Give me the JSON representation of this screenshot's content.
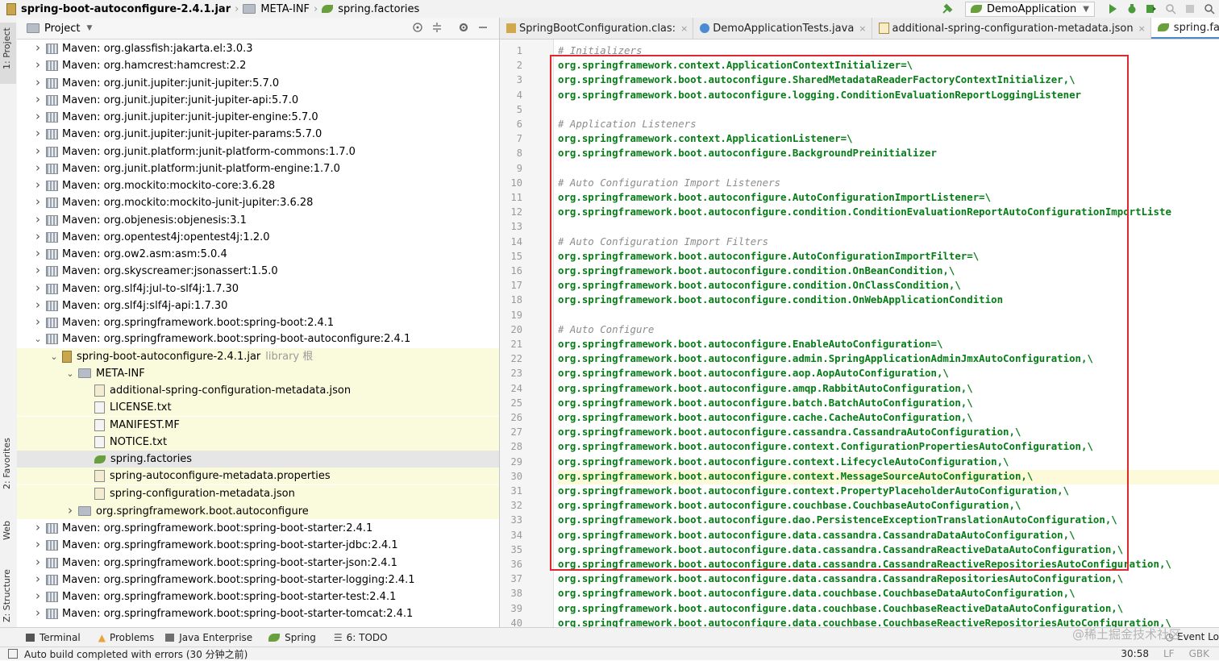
{
  "breadcrumb": [
    "spring-boot-autoconfigure-2.4.1.jar",
    "META-INF",
    "spring.factories"
  ],
  "run_config": "DemoApplication",
  "left_strip": [
    "1: Project",
    "2: Favorites",
    "Web",
    "Z: Structure"
  ],
  "project_panel": {
    "title": "Project"
  },
  "tree": [
    {
      "indent": 0,
      "chev": "right",
      "icon": "lib",
      "label": "Maven: org.glassfish:jakarta.el:3.0.3"
    },
    {
      "indent": 0,
      "chev": "right",
      "icon": "lib",
      "label": "Maven: org.hamcrest:hamcrest:2.2"
    },
    {
      "indent": 0,
      "chev": "right",
      "icon": "lib",
      "label": "Maven: org.junit.jupiter:junit-jupiter:5.7.0"
    },
    {
      "indent": 0,
      "chev": "right",
      "icon": "lib",
      "label": "Maven: org.junit.jupiter:junit-jupiter-api:5.7.0"
    },
    {
      "indent": 0,
      "chev": "right",
      "icon": "lib",
      "label": "Maven: org.junit.jupiter:junit-jupiter-engine:5.7.0"
    },
    {
      "indent": 0,
      "chev": "right",
      "icon": "lib",
      "label": "Maven: org.junit.jupiter:junit-jupiter-params:5.7.0"
    },
    {
      "indent": 0,
      "chev": "right",
      "icon": "lib",
      "label": "Maven: org.junit.platform:junit-platform-commons:1.7.0"
    },
    {
      "indent": 0,
      "chev": "right",
      "icon": "lib",
      "label": "Maven: org.junit.platform:junit-platform-engine:1.7.0"
    },
    {
      "indent": 0,
      "chev": "right",
      "icon": "lib",
      "label": "Maven: org.mockito:mockito-core:3.6.28"
    },
    {
      "indent": 0,
      "chev": "right",
      "icon": "lib",
      "label": "Maven: org.mockito:mockito-junit-jupiter:3.6.28"
    },
    {
      "indent": 0,
      "chev": "right",
      "icon": "lib",
      "label": "Maven: org.objenesis:objenesis:3.1"
    },
    {
      "indent": 0,
      "chev": "right",
      "icon": "lib",
      "label": "Maven: org.opentest4j:opentest4j:1.2.0"
    },
    {
      "indent": 0,
      "chev": "right",
      "icon": "lib",
      "label": "Maven: org.ow2.asm:asm:5.0.4"
    },
    {
      "indent": 0,
      "chev": "right",
      "icon": "lib",
      "label": "Maven: org.skyscreamer:jsonassert:1.5.0"
    },
    {
      "indent": 0,
      "chev": "right",
      "icon": "lib",
      "label": "Maven: org.slf4j:jul-to-slf4j:1.7.30"
    },
    {
      "indent": 0,
      "chev": "right",
      "icon": "lib",
      "label": "Maven: org.slf4j:slf4j-api:1.7.30"
    },
    {
      "indent": 0,
      "chev": "right",
      "icon": "lib",
      "label": "Maven: org.springframework.boot:spring-boot:2.4.1"
    },
    {
      "indent": 0,
      "chev": "down",
      "icon": "lib",
      "label": "Maven: org.springframework.boot:spring-boot-autoconfigure:2.4.1"
    },
    {
      "indent": 1,
      "chev": "down",
      "icon": "jar",
      "label": "spring-boot-autoconfigure-2.4.1.jar",
      "suffix": "library 根",
      "hl": true
    },
    {
      "indent": 2,
      "chev": "down",
      "icon": "folder",
      "label": "META-INF",
      "hl": true
    },
    {
      "indent": 3,
      "chev": "",
      "icon": "json",
      "label": "additional-spring-configuration-metadata.json",
      "hl": true
    },
    {
      "indent": 3,
      "chev": "",
      "icon": "file",
      "label": "LICENSE.txt",
      "hl": true
    },
    {
      "indent": 3,
      "chev": "",
      "icon": "file",
      "label": "MANIFEST.MF",
      "hl": true
    },
    {
      "indent": 3,
      "chev": "",
      "icon": "file",
      "label": "NOTICE.txt",
      "hl": true
    },
    {
      "indent": 3,
      "chev": "",
      "icon": "leaf",
      "label": "spring.factories",
      "sel": true
    },
    {
      "indent": 3,
      "chev": "",
      "icon": "json",
      "label": "spring-autoconfigure-metadata.properties",
      "hl": true
    },
    {
      "indent": 3,
      "chev": "",
      "icon": "json",
      "label": "spring-configuration-metadata.json",
      "hl": true
    },
    {
      "indent": 2,
      "chev": "right",
      "icon": "folder",
      "label": "org.springframework.boot.autoconfigure",
      "hl": true
    },
    {
      "indent": 0,
      "chev": "right",
      "icon": "lib",
      "label": "Maven: org.springframework.boot:spring-boot-starter:2.4.1"
    },
    {
      "indent": 0,
      "chev": "right",
      "icon": "lib",
      "label": "Maven: org.springframework.boot:spring-boot-starter-jdbc:2.4.1"
    },
    {
      "indent": 0,
      "chev": "right",
      "icon": "lib",
      "label": "Maven: org.springframework.boot:spring-boot-starter-json:2.4.1"
    },
    {
      "indent": 0,
      "chev": "right",
      "icon": "lib",
      "label": "Maven: org.springframework.boot:spring-boot-starter-logging:2.4.1"
    },
    {
      "indent": 0,
      "chev": "right",
      "icon": "lib",
      "label": "Maven: org.springframework.boot:spring-boot-starter-test:2.4.1"
    },
    {
      "indent": 0,
      "chev": "right",
      "icon": "lib",
      "label": "Maven: org.springframework.boot:spring-boot-starter-tomcat:2.4.1"
    }
  ],
  "tabs": [
    {
      "icon": "jico",
      "label": "SpringBootConfiguration.clas:"
    },
    {
      "icon": "cico",
      "label": "DemoApplicationTests.java"
    },
    {
      "icon": "json",
      "label": "additional-spring-configuration-metadata.json"
    },
    {
      "icon": "leaf",
      "label": "spring.factories",
      "active": true
    }
  ],
  "code": [
    {
      "t": "# Initializers",
      "c": true
    },
    {
      "t": "org.springframework.context.ApplicationContextInitializer=\\"
    },
    {
      "t": "org.springframework.boot.autoconfigure.SharedMetadataReaderFactoryContextInitializer,\\"
    },
    {
      "t": "org.springframework.boot.autoconfigure.logging.ConditionEvaluationReportLoggingListener"
    },
    {
      "t": ""
    },
    {
      "t": "# Application Listeners",
      "c": true
    },
    {
      "t": "org.springframework.context.ApplicationListener=\\"
    },
    {
      "t": "org.springframework.boot.autoconfigure.BackgroundPreinitializer"
    },
    {
      "t": ""
    },
    {
      "t": "# Auto Configuration Import Listeners",
      "c": true
    },
    {
      "t": "org.springframework.boot.autoconfigure.AutoConfigurationImportListener=\\"
    },
    {
      "t": "org.springframework.boot.autoconfigure.condition.ConditionEvaluationReportAutoConfigurationImportListe"
    },
    {
      "t": ""
    },
    {
      "t": "# Auto Configuration Import Filters",
      "c": true
    },
    {
      "t": "org.springframework.boot.autoconfigure.AutoConfigurationImportFilter=\\"
    },
    {
      "t": "org.springframework.boot.autoconfigure.condition.OnBeanCondition,\\"
    },
    {
      "t": "org.springframework.boot.autoconfigure.condition.OnClassCondition,\\"
    },
    {
      "t": "org.springframework.boot.autoconfigure.condition.OnWebApplicationCondition"
    },
    {
      "t": ""
    },
    {
      "t": "# Auto Configure",
      "c": true
    },
    {
      "t": "org.springframework.boot.autoconfigure.EnableAutoConfiguration=\\"
    },
    {
      "t": "org.springframework.boot.autoconfigure.admin.SpringApplicationAdminJmxAutoConfiguration,\\"
    },
    {
      "t": "org.springframework.boot.autoconfigure.aop.AopAutoConfiguration,\\"
    },
    {
      "t": "org.springframework.boot.autoconfigure.amqp.RabbitAutoConfiguration,\\"
    },
    {
      "t": "org.springframework.boot.autoconfigure.batch.BatchAutoConfiguration,\\"
    },
    {
      "t": "org.springframework.boot.autoconfigure.cache.CacheAutoConfiguration,\\"
    },
    {
      "t": "org.springframework.boot.autoconfigure.cassandra.CassandraAutoConfiguration,\\"
    },
    {
      "t": "org.springframework.boot.autoconfigure.context.ConfigurationPropertiesAutoConfiguration,\\"
    },
    {
      "t": "org.springframework.boot.autoconfigure.context.LifecycleAutoConfiguration,\\"
    },
    {
      "t": "org.springframework.boot.autoconfigure.context.MessageSourceAutoConfiguration,\\",
      "cur": true
    },
    {
      "t": "org.springframework.boot.autoconfigure.context.PropertyPlaceholderAutoConfiguration,\\"
    },
    {
      "t": "org.springframework.boot.autoconfigure.couchbase.CouchbaseAutoConfiguration,\\"
    },
    {
      "t": "org.springframework.boot.autoconfigure.dao.PersistenceExceptionTranslationAutoConfiguration,\\"
    },
    {
      "t": "org.springframework.boot.autoconfigure.data.cassandra.CassandraDataAutoConfiguration,\\"
    },
    {
      "t": "org.springframework.boot.autoconfigure.data.cassandra.CassandraReactiveDataAutoConfiguration,\\"
    },
    {
      "t": "org.springframework.boot.autoconfigure.data.cassandra.CassandraReactiveRepositoriesAutoConfiguration,\\"
    },
    {
      "t": "org.springframework.boot.autoconfigure.data.cassandra.CassandraRepositoriesAutoConfiguration,\\"
    },
    {
      "t": "org.springframework.boot.autoconfigure.data.couchbase.CouchbaseDataAutoConfiguration,\\"
    },
    {
      "t": "org.springframework.boot.autoconfigure.data.couchbase.CouchbaseReactiveDataAutoConfiguration,\\"
    },
    {
      "t": "org.springframework.boot.autoconfigure.data.couchbase.CouchbaseReactiveRepositoriesAutoConfiguration,\\"
    }
  ],
  "bottom_tools": [
    "Terminal",
    "Problems",
    "Java Enterprise",
    "Spring",
    "6: TODO"
  ],
  "event_log": "Event Lo",
  "status": {
    "message": "Auto build completed with errors (30 分钟之前)",
    "position": "30:58",
    "line_sep": "LF",
    "encoding": "GBK"
  },
  "watermark": "@稀土掘金技术社区"
}
